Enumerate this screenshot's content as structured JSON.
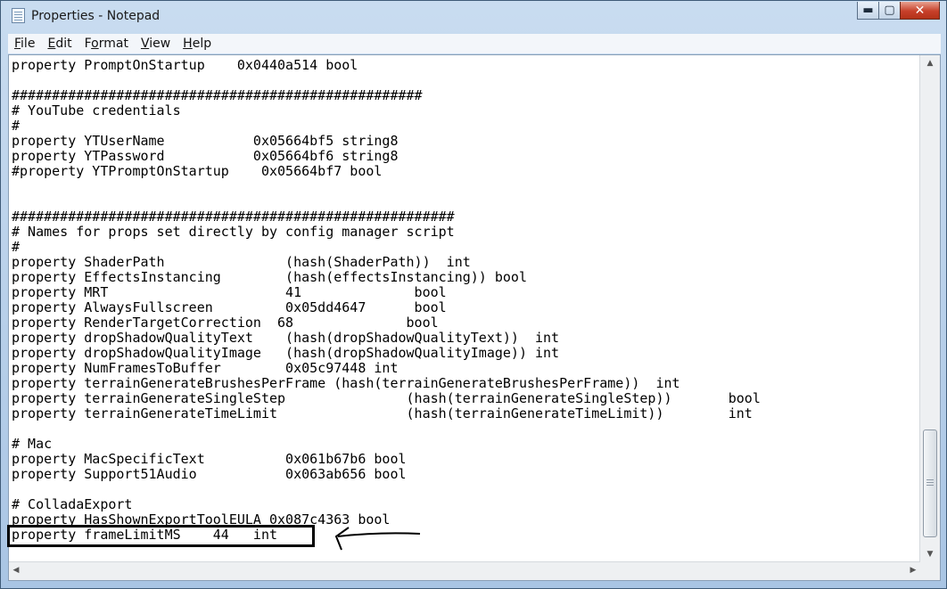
{
  "window": {
    "title": "Properties - Notepad"
  },
  "menu": [
    {
      "id": "file",
      "underline": "F",
      "rest": "ile"
    },
    {
      "id": "edit",
      "underline": "E",
      "rest": "dit"
    },
    {
      "id": "format",
      "pre": "F",
      "underline": "o",
      "rest": "rmat"
    },
    {
      "id": "view",
      "underline": "V",
      "rest": "iew"
    },
    {
      "id": "help",
      "underline": "H",
      "rest": "elp"
    }
  ],
  "document": {
    "text": "property PromptOnStartup    0x0440a514 bool\n\n###################################################\n# YouTube credentials\n#\nproperty YTUserName           0x05664bf5 string8\nproperty YTPassword           0x05664bf6 string8\n#property YTPromptOnStartup    0x05664bf7 bool\n\n\n#######################################################\n# Names for props set directly by config manager script\n#\nproperty ShaderPath               (hash(ShaderPath))  int\nproperty EffectsInstancing        (hash(effectsInstancing)) bool\nproperty MRT                      41              bool\nproperty AlwaysFullscreen         0x05dd4647      bool\nproperty RenderTargetCorrection  68              bool\nproperty dropShadowQualityText    (hash(dropShadowQualityText))  int\nproperty dropShadowQualityImage   (hash(dropShadowQualityImage)) int\nproperty NumFramesToBuffer        0x05c97448 int\nproperty terrainGenerateBrushesPerFrame (hash(terrainGenerateBrushesPerFrame))  int\nproperty terrainGenerateSingleStep               (hash(terrainGenerateSingleStep))       bool\nproperty terrainGenerateTimeLimit                (hash(terrainGenerateTimeLimit))        int\n\n# Mac\nproperty MacSpecificText          0x061b67b6 bool\nproperty Support51Audio           0x063ab656 bool\n\n# ColladaExport\nproperty HasShownExportToolEULA 0x087c4363 bool\nproperty frameLimitMS    44   int"
  }
}
